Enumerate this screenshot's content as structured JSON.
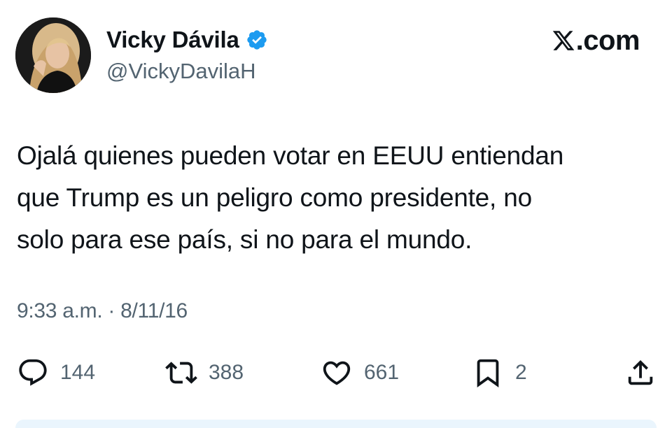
{
  "author": {
    "name": "Vicky Dávila",
    "handle": "@VickyDavilaH",
    "verified": true,
    "avatar": "profile-photo"
  },
  "brand": {
    "icon": "x-logo-icon",
    "text": ".com"
  },
  "tweet": {
    "lines": [
      "Ojalá quienes pueden votar en EEUU entiendan",
      "que Trump es un peligro como presidente, no",
      "solo para ese país, si no para el mundo."
    ],
    "time": "9:33 a.m.",
    "separator": " · ",
    "date": "8/11/16"
  },
  "actions": {
    "replies": "144",
    "retweets": "388",
    "likes": "661",
    "bookmarks": "2",
    "share_icon": "share-icon"
  },
  "colors": {
    "text": "#0f1419",
    "secondary": "#536471",
    "verified": "#1d9bf0",
    "background": "#ffffff"
  }
}
